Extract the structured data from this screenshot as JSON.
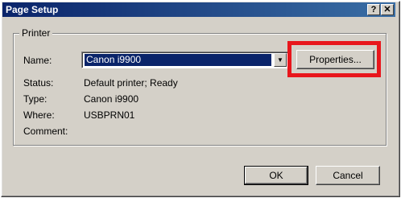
{
  "window": {
    "title": "Page Setup",
    "help_label": "?",
    "close_label": "✕"
  },
  "printer": {
    "group_label": "Printer",
    "name_label": "Name:",
    "name_value": "Canon i9900",
    "dropdown_arrow": "▼",
    "properties_label": "Properties...",
    "status_label": "Status:",
    "status_value": "Default printer; Ready",
    "type_label": "Type:",
    "type_value": "Canon i9900",
    "where_label": "Where:",
    "where_value": "USBPRN01",
    "comment_label": "Comment:",
    "comment_value": ""
  },
  "buttons": {
    "ok_label": "OK",
    "cancel_label": "Cancel"
  },
  "colors": {
    "highlight": "#e8161c",
    "titlebar": "#0a246a",
    "selection": "#0a246a"
  }
}
